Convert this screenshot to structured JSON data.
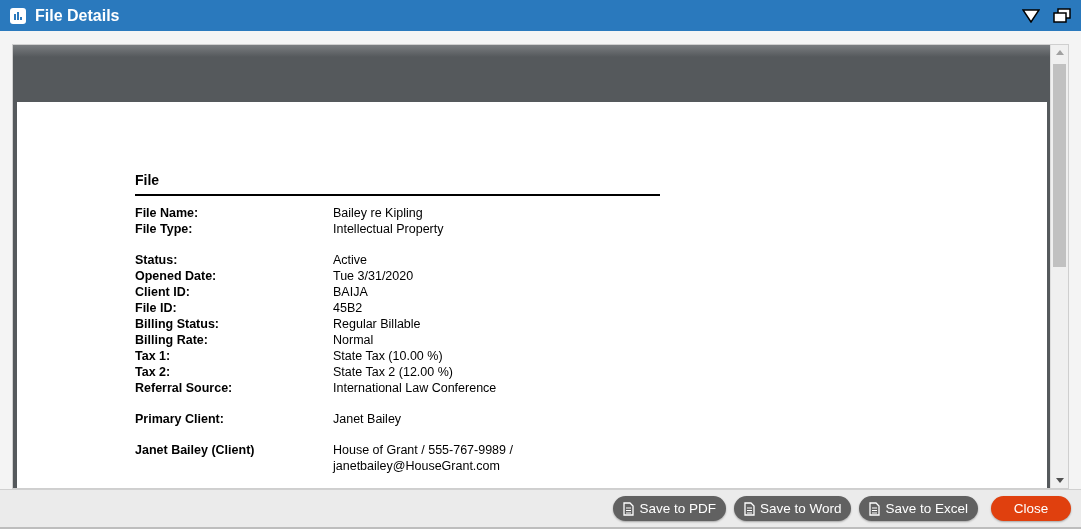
{
  "window": {
    "title": "File Details"
  },
  "document": {
    "section_title": "File",
    "groups": [
      [
        {
          "label": "File Name:",
          "value": "Bailey re Kipling"
        },
        {
          "label": "File Type:",
          "value": "Intellectual Property"
        }
      ],
      [
        {
          "label": "Status:",
          "value": "Active"
        },
        {
          "label": "Opened Date:",
          "value": "Tue 3/31/2020"
        },
        {
          "label": "Client ID:",
          "value": "BAIJA"
        },
        {
          "label": "File ID:",
          "value": "45B2"
        },
        {
          "label": "Billing Status:",
          "value": "Regular Billable"
        },
        {
          "label": "Billing Rate:",
          "value": "Normal"
        },
        {
          "label": "Tax 1:",
          "value": "State Tax (10.00 %)"
        },
        {
          "label": "Tax 2:",
          "value": "State Tax 2 (12.00 %)"
        },
        {
          "label": "Referral Source:",
          "value": "International Law Conference"
        }
      ],
      [
        {
          "label": "Primary Client:",
          "value": "Janet Bailey"
        }
      ],
      [
        {
          "label": "Janet Bailey (Client)",
          "value": "House of Grant / 555-767-9989 / janetbailey@HouseGrant.com"
        }
      ]
    ]
  },
  "buttons": [
    {
      "label": "Save to PDF",
      "kind": "export"
    },
    {
      "label": "Save to Word",
      "kind": "export"
    },
    {
      "label": "Save to Excel",
      "kind": "export"
    },
    {
      "label": "Close",
      "kind": "primary"
    }
  ]
}
